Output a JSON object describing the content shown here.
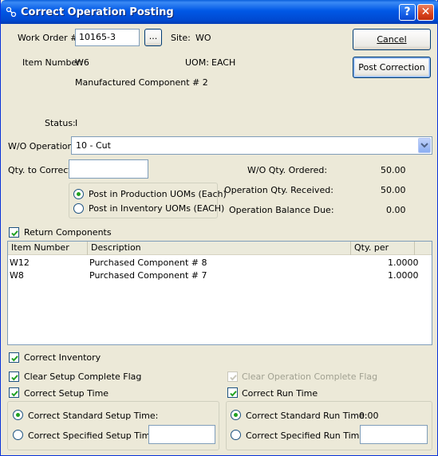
{
  "window": {
    "title": "Correct Operation Posting",
    "help_glyph": "?",
    "close_glyph": "✕"
  },
  "buttons": {
    "cancel": "Cancel",
    "post": "Post Correction",
    "lookup": "..."
  },
  "header": {
    "work_order_label": "Work Order #:",
    "work_order_value": "10165-3",
    "site_label": "Site:",
    "site_value": "WO",
    "item_number_label": "Item Number:",
    "item_number_value": "W6",
    "uom_label": "UOM:",
    "uom_value": "EACH",
    "item_description": "Manufactured Component # 2",
    "status_label": "Status:",
    "status_value": "I"
  },
  "operation": {
    "label": "W/O Operation:",
    "value": "10 - Cut"
  },
  "qty": {
    "label": "Qty. to Correct:",
    "value": "",
    "post_production": "Post in Production UOMs (Each)",
    "post_inventory": "Post in Inventory UOMs (EACH)",
    "selected": "production",
    "ordered_label": "W/O Qty. Ordered:",
    "ordered_value": "50.00",
    "received_label": "Operation Qty. Received:",
    "received_value": "50.00",
    "balance_label": "Operation Balance Due:",
    "balance_value": "0.00"
  },
  "return_components": {
    "label": "Return Components",
    "checked": true,
    "columns": [
      "Item Number",
      "Description",
      "Qty. per"
    ],
    "rows": [
      {
        "item": "W12",
        "description": "Purchased Component # 8",
        "qty": "1.0000"
      },
      {
        "item": "W8",
        "description": "Purchased Component # 7",
        "qty": "1.0000"
      }
    ]
  },
  "options": {
    "correct_inventory": "Correct Inventory",
    "clear_setup": "Clear Setup Complete Flag",
    "clear_operation": "Clear Operation Complete Flag",
    "correct_setup_time": "Correct Setup Time",
    "correct_run_time": "Correct Run Time"
  },
  "setup_group": {
    "standard_label": "Correct Standard Setup Time:",
    "specified_label": "Correct Specified Setup Time:",
    "specified_value": ""
  },
  "run_group": {
    "standard_label": "Correct Standard Run Time:",
    "standard_value": "0.00",
    "specified_label": "Correct Specified Run Time:",
    "specified_value": ""
  },
  "colors": {
    "titlebar": "#0058e6",
    "face": "#ece9d8",
    "radio_dot": "#21a121",
    "check": "#21a121"
  }
}
